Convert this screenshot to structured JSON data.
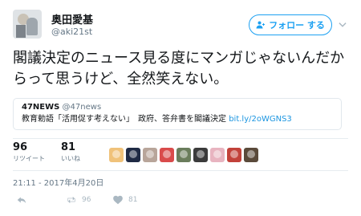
{
  "author": {
    "display_name": "奥田愛基",
    "handle": "@aki21st",
    "avatar_icon": "user-avatar"
  },
  "follow_button": {
    "label": "フォロー する",
    "icon": "person-add-icon",
    "color": "#1da1f2"
  },
  "menu_icon": "chevron-down-icon",
  "tweet": {
    "text": "閣議決定のニュース見る度にマンガじゃないんだからって思うけど、全然笑えない。"
  },
  "quoted": {
    "name": "47NEWS",
    "handle": "@47news",
    "text": "教育勅語「活用促す考えない」　政府、答弁書を閣議決定",
    "link": "bit.ly/2oWGNS3"
  },
  "stats": {
    "retweets": {
      "count": "96",
      "label": "リツイート"
    },
    "likes": {
      "count": "81",
      "label": "いいね"
    }
  },
  "likers": [
    {
      "icon": "liker-avatar-1",
      "color": "#f0c27a"
    },
    {
      "icon": "liker-avatar-2",
      "color": "#1f2a44"
    },
    {
      "icon": "liker-avatar-3",
      "color": "#b8a59a"
    },
    {
      "icon": "liker-avatar-4",
      "color": "#d94b4b"
    },
    {
      "icon": "liker-avatar-5",
      "color": "#6a7d5c"
    },
    {
      "icon": "liker-avatar-6",
      "color": "#3b3b3b"
    },
    {
      "icon": "liker-avatar-7",
      "color": "#e8b4c0"
    },
    {
      "icon": "liker-avatar-8",
      "color": "#c2423a"
    },
    {
      "icon": "liker-avatar-9",
      "color": "#5a4a3a"
    }
  ],
  "timestamp": "21:11 - 2017年4月20日",
  "actions": {
    "reply_icon": "reply-icon",
    "retweet_icon": "retweet-icon",
    "retweet_count": "96",
    "like_icon": "heart-icon",
    "like_count": "81"
  }
}
